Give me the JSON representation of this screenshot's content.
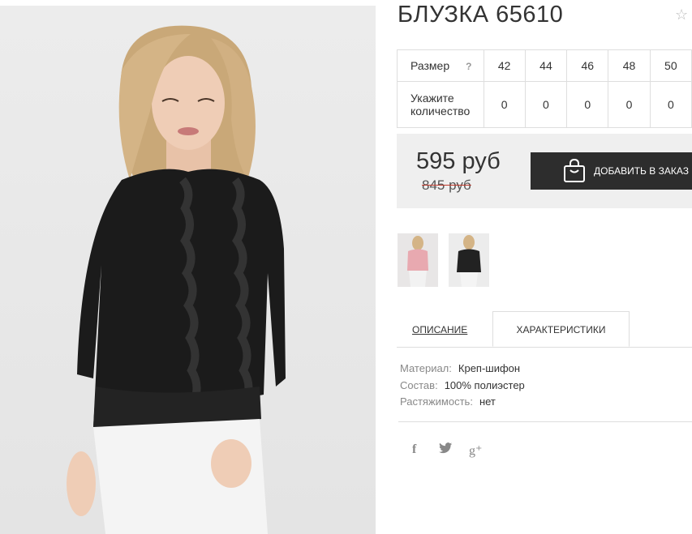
{
  "product": {
    "title": "БЛУЗКА 65610",
    "favorite_icon": "star-outline-icon"
  },
  "sizes": {
    "size_label": "Размер",
    "help_mark": "?",
    "quantity_label": "Укажите количество",
    "columns": [
      "42",
      "44",
      "46",
      "48",
      "50"
    ],
    "quantities": [
      "0",
      "0",
      "0",
      "0",
      "0"
    ]
  },
  "pricing": {
    "price": "595 руб",
    "old_price": "845 руб",
    "add_button": "ДОБАВИТЬ В ЗАКАЗ",
    "old_price_strike_color": "#c0392b"
  },
  "tabs": {
    "description": "ОПИСАНИЕ",
    "characteristics": "ХАРАКТЕРИСТИКИ"
  },
  "specs": [
    {
      "key": "Материал:",
      "value": "Креп-шифон"
    },
    {
      "key": "Состав:",
      "value": "100% полиэстер"
    },
    {
      "key": "Растяжимость:",
      "value": "нет"
    }
  ],
  "social": {
    "facebook": "f",
    "google": "g⁺"
  },
  "colors": {
    "button_bg": "#2d2d2d",
    "price_box_bg": "#efefef"
  }
}
